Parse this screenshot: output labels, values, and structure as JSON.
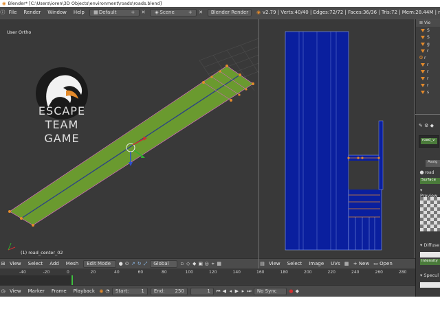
{
  "window": {
    "title": "Blender* [C:\\Users\\ioren\\3D Objects\\environment\\roads\\roads.blend]"
  },
  "menu": {
    "items": [
      "File",
      "Render",
      "Window",
      "Help"
    ],
    "layout": "Default",
    "scene": "Scene",
    "engine": "Blender Render",
    "stats": "v2.79 | Verts:40/40 | Edges:72/72 | Faces:36/36 | Tris:72 | Mem:28.44M | r"
  },
  "viewport3d": {
    "view_label": "User Ortho",
    "object_label": "(1) road_center_02",
    "logo": {
      "line1": "ESCAPE",
      "line2": "TEAM",
      "line3": "GAME"
    }
  },
  "header3d": {
    "items": [
      "View",
      "Select",
      "Add",
      "Mesh"
    ],
    "mode": "Edit Mode",
    "orientation": "Global"
  },
  "headeruv": {
    "items": [
      "View",
      "Select",
      "Image",
      "UVs"
    ],
    "new": "+ New",
    "open": "Open"
  },
  "outliner": {
    "header": "Vie",
    "rows": [
      {
        "label": "S",
        "icon": "triangle"
      },
      {
        "label": "S",
        "icon": "triangle"
      },
      {
        "label": "g",
        "icon": "triangle"
      },
      {
        "label": "r",
        "icon": "triangle"
      },
      {
        "label": "r",
        "icon": "gear"
      },
      {
        "label": "r",
        "icon": "triangle"
      },
      {
        "label": "r",
        "icon": "triangle"
      },
      {
        "label": "r",
        "icon": "triangle"
      },
      {
        "label": "r",
        "icon": "triangle"
      },
      {
        "label": "s",
        "icon": "triangle"
      }
    ]
  },
  "properties": {
    "material_slot": "road_v",
    "assign": "Assig",
    "material_name": "road",
    "surface": "Surface",
    "preview": "Preview",
    "diffuse": "Diffuse",
    "intensity": "Intensity",
    "specular": "Specul"
  },
  "timeline": {
    "ticks": [
      "-40",
      "-20",
      "0",
      "20",
      "40",
      "60",
      "80",
      "100",
      "120",
      "140",
      "160",
      "180",
      "200",
      "220",
      "240",
      "260",
      "280"
    ]
  },
  "timeline_footer": {
    "items": [
      "View",
      "Marker",
      "Frame",
      "Playback"
    ],
    "start_label": "Start:",
    "start": "1",
    "end_label": "End:",
    "end": "250",
    "current": "1",
    "sync": "No Sync"
  },
  "colors": {
    "road_green": "#6a9a2f",
    "uv_blue": "#0a1f9e",
    "selected_orange": "#e38a2b",
    "panel_bg": "#393939"
  }
}
